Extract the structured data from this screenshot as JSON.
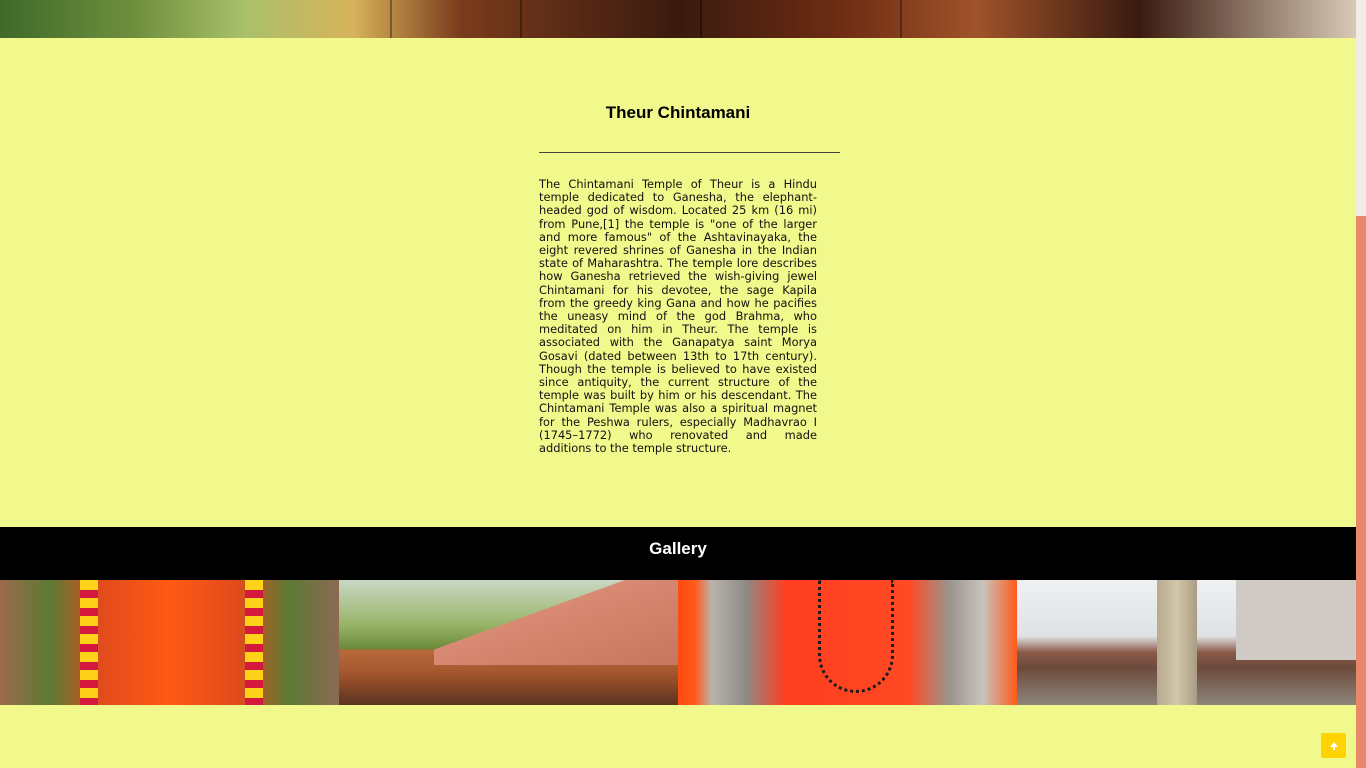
{
  "temple": {
    "title": "Theur Chintamani",
    "description": "The Chintamani Temple of Theur is a Hindu temple dedicated to Ganesha, the elephant-headed god of wisdom. Located 25 km (16 mi) from Pune,[1] the temple is \"one of the larger and more famous\" of the Ashtavinayaka, the eight revered shrines of Ganesha in the Indian state of Maharashtra. The temple lore describes how Ganesha retrieved the wish-giving jewel Chintamani for his devotee, the sage Kapila from the greedy king Gana and how he pacifies the uneasy mind of the god Brahma, who meditated on him in Theur. The temple is associated with the Ganapatya saint Morya Gosavi (dated between 13th to 17th century). Though the temple is believed to have existed since antiquity, the current structure of the temple was built by him or his descendant. The Chintamani Temple was also a spiritual magnet for the Peshwa rulers, especially Madhavrao I (1745–1772) who renovated and made additions to the temple structure."
  },
  "gallery": {
    "heading": "Gallery",
    "images": [
      "ganesha-idol-photo",
      "temple-hall-photo",
      "ganesha-idol-closeup-photo",
      "temple-pillar-photo"
    ]
  },
  "colors": {
    "page_background": "#f1f98c",
    "gallery_bar": "#000000",
    "scroll_thumb": "#e8876a",
    "top_button": "#ffd400"
  },
  "icons": {
    "top_button": "arrow-up-icon"
  }
}
